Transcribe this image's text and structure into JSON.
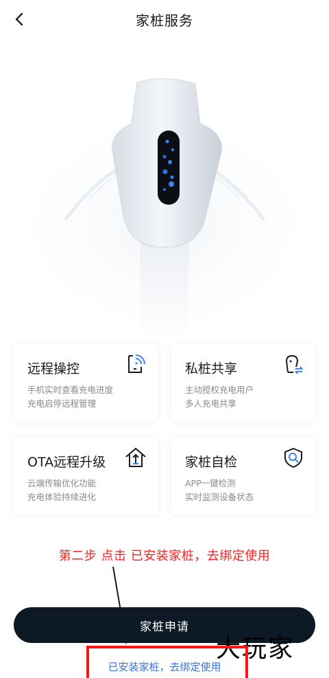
{
  "header": {
    "title": "家桩服务",
    "back_icon": "chevron-left-icon"
  },
  "cards": [
    {
      "title": "远程操控",
      "line1": "手机实时查看充电进度",
      "line2": "充电启停远程管理",
      "icon": "phone-signal-icon"
    },
    {
      "title": "私桩共享",
      "line1": "主动授权充电用户",
      "line2": "多人充电共享",
      "icon": "charger-share-icon"
    },
    {
      "title": "OTA远程升级",
      "line1": "云端传输优化功能",
      "line2": "充电体验持续进化",
      "icon": "house-upgrade-icon"
    },
    {
      "title": "家桩自检",
      "line1": "APP一键检测",
      "line2": "实时监测设备状态",
      "icon": "shield-search-icon"
    }
  ],
  "annotation": "第二步 点击 已安装家桩，去绑定使用",
  "buttons": {
    "apply_label": "家桩申请",
    "installed_label": "已安装家桩，去绑定使用"
  },
  "watermark": "大玩家",
  "colors": {
    "button_bg": "#0d1a26",
    "link": "#3b6fd9",
    "annotation": "#ff1d1d",
    "icon_accent": "#3b82f6"
  }
}
